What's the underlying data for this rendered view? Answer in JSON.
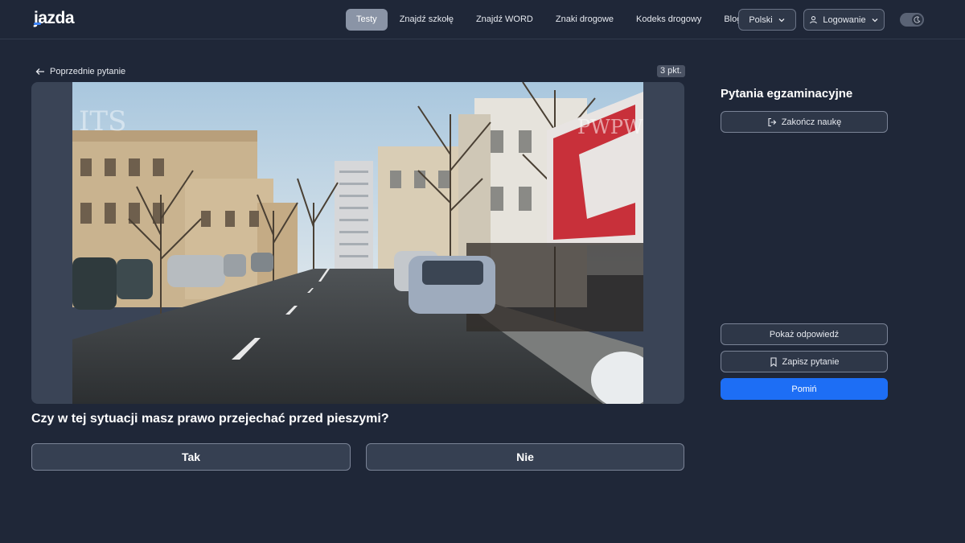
{
  "header": {
    "logo": "jazda",
    "nav": [
      {
        "label": "Testy",
        "active": true
      },
      {
        "label": "Znajdź szkołę",
        "active": false
      },
      {
        "label": "Znajdź WORD",
        "active": false
      },
      {
        "label": "Znaki drogowe",
        "active": false
      },
      {
        "label": "Kodeks drogowy",
        "active": false
      },
      {
        "label": "Blog",
        "active": false
      }
    ],
    "language": "Polski",
    "login": "Logowanie"
  },
  "question_panel": {
    "back_label": "Poprzednie pytanie",
    "points": "3 pkt.",
    "watermark_left": "ITS",
    "watermark_right": "PWPW",
    "question": "Czy w tej sytuacji masz prawo przejechać przed pieszymi?",
    "answers": {
      "yes": "Tak",
      "no": "Nie"
    }
  },
  "sidebar": {
    "title": "Pytania egzaminacyjne",
    "end_label": "Zakończ naukę",
    "show_answer_label": "Pokaż odpowiedź",
    "save_label": "Zapisz pytanie",
    "skip_label": "Pomiń"
  },
  "colors": {
    "background": "#1f2738",
    "primary": "#1d6ef5",
    "active_nav": "#8a94a6"
  }
}
